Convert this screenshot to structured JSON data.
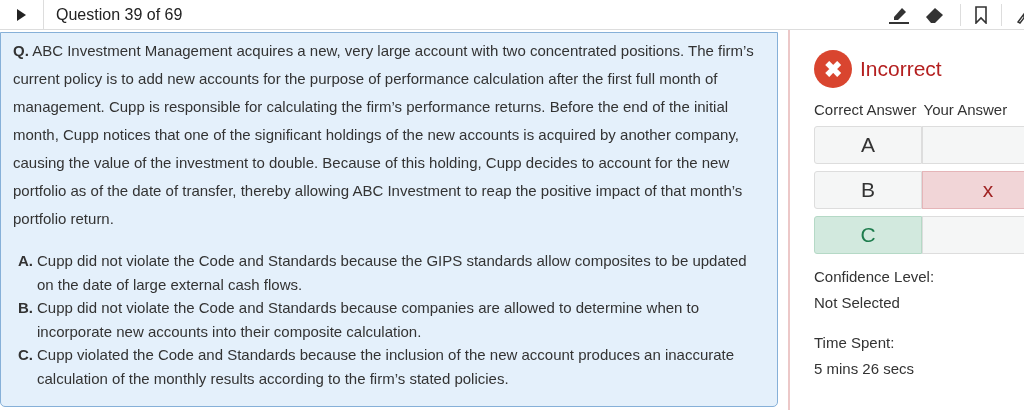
{
  "header": {
    "title": "Question 39 of 69"
  },
  "question": {
    "label": "Q.",
    "text": "ABC Investment Management acquires a new, very large account with two concentrated positions. The firm’s current policy is to add new accounts for the purpose of performance calculation after the first full month of management. Cupp is responsible for calculating the firm’s performance returns. Before the end of the initial month, Cupp notices that one of the significant holdings of the new accounts is acquired by another company, causing the value of the investment to double. Because of this holding, Cupp decides to account for the new portfolio as of the date of transfer, thereby allowing ABC Investment to reap the positive impact of that month’s portfolio return."
  },
  "choices": [
    {
      "letter": "A.",
      "text": "Cupp did not violate the Code and Standards because the GIPS standards allow composites to be updated on the date of large external cash flows."
    },
    {
      "letter": "B.",
      "text": "Cupp did not violate the Code and Standards because companies are allowed to determine when to incorporate new accounts into their composite calculation."
    },
    {
      "letter": "C.",
      "text": "Cupp violated the Code and Standards because the inclusion of the new account produces an inaccurate calculation of the monthly results according to the firm’s stated policies."
    }
  ],
  "result": {
    "status": "Incorrect",
    "icon": "✖",
    "columns": [
      "Correct Answer",
      "Your Answer"
    ],
    "rows": [
      {
        "letter": "A",
        "correct": false,
        "chosen": false,
        "mark": ""
      },
      {
        "letter": "B",
        "correct": false,
        "chosen": true,
        "mark": "x"
      },
      {
        "letter": "C",
        "correct": true,
        "chosen": false,
        "mark": ""
      }
    ],
    "confidence_label": "Confidence Level:",
    "confidence_value": "Not Selected",
    "time_label": "Time Spent:",
    "time_value": "5 mins 26 secs"
  }
}
